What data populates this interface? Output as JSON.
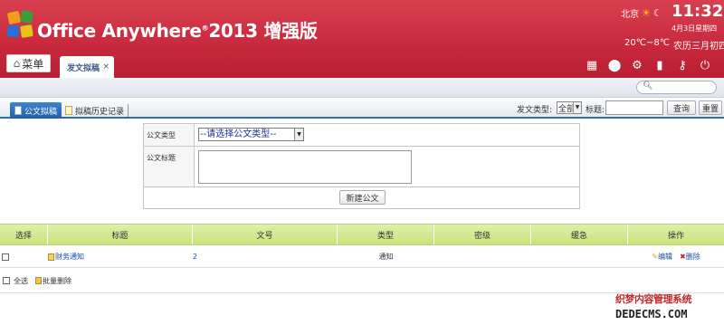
{
  "header": {
    "app_name": "Office Anywhere",
    "reg_mark": "®",
    "app_suffix": "2013 增强版",
    "weather_city": "北京",
    "time": "11:32",
    "date": "4月3日星期四",
    "temperature": "20℃~8℃",
    "lunar_date": "农历三月初四",
    "colors": {
      "header_bg": "#c8283c",
      "accent_blue": "#2d6bb8",
      "table_head": "#d4e98f"
    }
  },
  "nav": {
    "menu_label": "菜单",
    "open_tab_label": "发文拟稿",
    "close_glyph": "×",
    "tool_icons": [
      "apps-icon",
      "help-icon",
      "settings-icon",
      "power-icon",
      "key-icon",
      "shutdown-icon"
    ]
  },
  "subtabs": {
    "active": "公文拟稿",
    "history": "拟稿历史记录"
  },
  "filter": {
    "type_label": "发文类型:",
    "type_value": "全部",
    "title_label": "标题:",
    "query_button": "查询",
    "reset_button": "重置"
  },
  "form": {
    "type_label": "公文类型",
    "type_placeholder": "--请选择公文类型--",
    "title_label": "公文标题",
    "submit_button": "新建公文"
  },
  "table": {
    "headers": [
      "选择",
      "标题",
      "文号",
      "类型",
      "密级",
      "缓急",
      "操作"
    ],
    "rows": [
      {
        "title": "财务通知",
        "doc_no": "2",
        "type": "通知",
        "secrecy": "",
        "urgency": "",
        "edit": "编辑",
        "delete": "删除"
      }
    ],
    "select_all": "全选",
    "batch_delete": "批量删除"
  },
  "watermark": {
    "line1": "织梦内容管理系统",
    "line2": "DEDECMS.COM"
  }
}
